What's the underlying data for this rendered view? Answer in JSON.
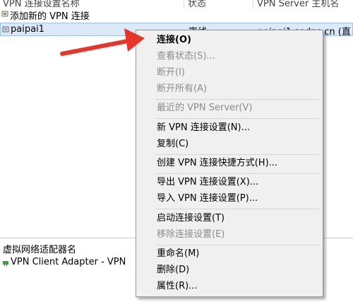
{
  "list": {
    "header": {
      "name_col": "VPN 连接设置名称",
      "status_col": "状态",
      "server_col": "VPN Server 主机名"
    },
    "rows": [
      {
        "name": "添加新的 VPN 连接",
        "status": "",
        "server": ""
      },
      {
        "name": "paipai1",
        "status": "离线",
        "server": "paipai1.sedns.cn (直"
      }
    ]
  },
  "adapters": {
    "header": "虚拟网络适配器名",
    "rows": [
      {
        "name": "VPN Client Adapter - VPN"
      }
    ]
  },
  "context_menu": {
    "items": [
      {
        "label": "连接(O)",
        "disabled": false,
        "bold": true
      },
      {
        "label": "查看状态(S)...",
        "disabled": true
      },
      {
        "label": "断开(I)",
        "disabled": true
      },
      {
        "label": "断开所有(A)",
        "disabled": true
      },
      {
        "label": "最近的 VPN Server(V)",
        "disabled": true
      },
      {
        "label": "新 VPN 连接设置(N)...",
        "disabled": false
      },
      {
        "label": "复制(C)",
        "disabled": false
      },
      {
        "label": "创建 VPN 连接快捷方式(H)...",
        "disabled": false
      },
      {
        "label": "导出 VPN 连接设置(X)...",
        "disabled": false
      },
      {
        "label": "导入 VPN 连接设置(P)...",
        "disabled": false
      },
      {
        "label": "启动连接设置(T)",
        "disabled": false
      },
      {
        "label": "移除连接设置(E)",
        "disabled": true
      },
      {
        "label": "重命名(M)",
        "disabled": false
      },
      {
        "label": "删除(D)",
        "disabled": false
      },
      {
        "label": "属性(R)...",
        "disabled": false
      }
    ]
  },
  "colors": {
    "arrow": "#e8352a",
    "selection_bg": "#dbe9f9",
    "menu_bg": "#f0f0f0",
    "disabled_text": "#8c8c8c"
  }
}
